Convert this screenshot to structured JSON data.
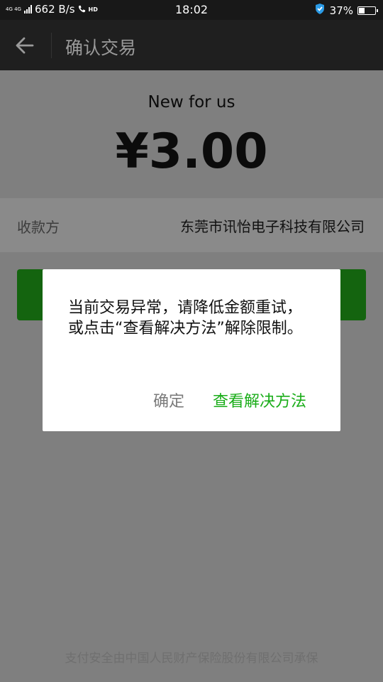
{
  "status_bar": {
    "network": "4G 4G",
    "speed": "662 B/s",
    "hd": "HD",
    "time": "18:02",
    "battery_percent": "37%",
    "battery_level": 0.37
  },
  "app_bar": {
    "title": "确认交易"
  },
  "transaction": {
    "merchant": "New for us",
    "amount": "¥3.00",
    "payee_label": "收款方",
    "payee_value": "东莞市讯怡电子科技有限公司"
  },
  "dialog": {
    "message": "当前交易异常，请降低金额重试，或点击“查看解决方法”解除限制。",
    "confirm_label": "确定",
    "solution_label": "查看解决方法"
  },
  "footer": {
    "text": "支付安全由中国人民财产保险股份有限公司承保"
  },
  "colors": {
    "accent_green": "#1aad19",
    "pay_button_dimmed": "#14640f"
  }
}
